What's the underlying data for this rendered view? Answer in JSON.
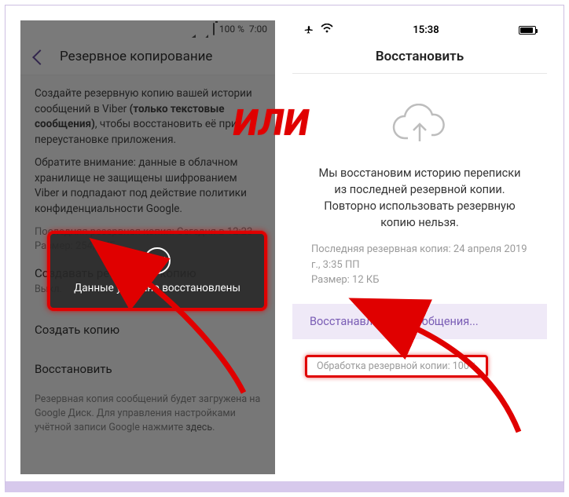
{
  "or_label": "ИЛИ",
  "android": {
    "statusbar": {
      "battery_pct": "100 %",
      "time": "7:00"
    },
    "appbar": {
      "title": "Резервное копирование"
    },
    "intro_part1": "Создайте резервную копию вашей истории сообщений в Viber ",
    "intro_bold": "(только текстовые сообщения)",
    "intro_part2": ", чтобы восстановить её при переустановке приложения.",
    "warning": "Обратите внимание: данные в облачном хранилище не защищены шифрованием Viber и подпадают под действие политики конфиденциальности Google.",
    "last_backup": "Последняя резервная копия: Сегодня в 12:23",
    "size": "Размер: 254,2 КБ",
    "auto_title": "Создавать резервную копию",
    "auto_value": "Выкл.",
    "create_title": "Создать копию",
    "restore_title": "Восстановить",
    "restore_desc1": "Резервная копия сообщений будет загружена на Google Диск. Для управления настройками учётной записи Google нажмите ",
    "restore_desc_link": "здесь",
    "toast": "Данные успешно восстановлены"
  },
  "ios": {
    "statusbar": {
      "time": "15:38"
    },
    "navbar": {
      "title": "Восстановить"
    },
    "body_text": "Мы восстановим историю переписки из последней резервной копии. Повторно использовать резервную копию нельзя.",
    "last_backup": "Последняя резервная копия: 24 апреля 2019 г., 3:35 ПП",
    "size": "Размер: 12 КБ",
    "progress_band": "Восстанавливаем сообщения...",
    "progress_text": "Обработка резервной копии: 100%"
  }
}
